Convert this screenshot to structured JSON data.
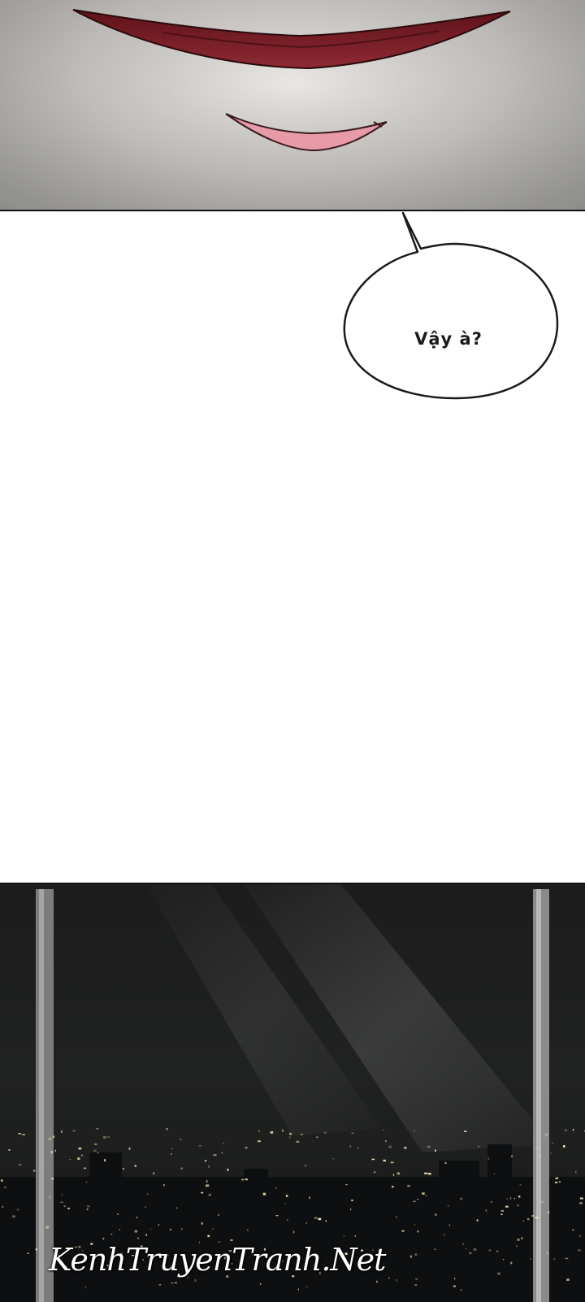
{
  "speech_bubble": {
    "text": "Vậy à?"
  },
  "watermark": {
    "text": "KenhTruyenTranh.Net"
  },
  "colors": {
    "lips_upper": "#7a1e27",
    "lips_lower": "#e79aa8",
    "bubble_border": "#1a1a1a",
    "night_bg": "#1c1c1c",
    "city_lights": "#f4e3b0"
  }
}
